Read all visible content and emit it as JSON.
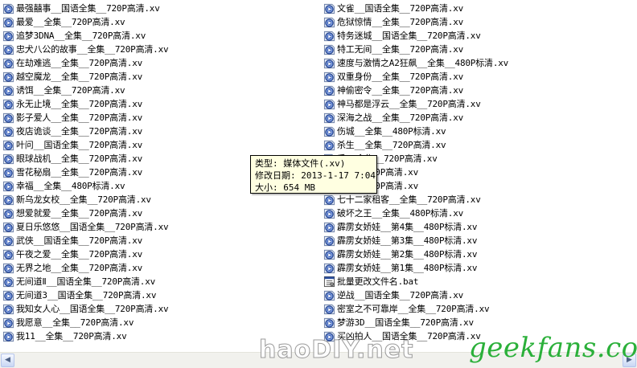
{
  "files_left": [
    "最强囍事__国语全集__720P高清.xv",
    "最爱__全集__720P高清.xv",
    "追梦3DNA__全集__720P高清.xv",
    "忠犬八公的故事__全集__720P高清.xv",
    "在劫难逃__全集__720P高清.xv",
    "越空魔龙__全集__720P高清.xv",
    "诱饵__全集__720P高清.xv",
    "永无止境__全集__720P高清.xv",
    "影子爱人__全集__720P高清.xv",
    "夜店诡谈__全集__720P高清.xv",
    "叶问__国语全集__720P高清.xv",
    "眼球战机__全集__720P高清.xv",
    "雪花秘扇__全集__720P高清.xv",
    "幸福__全集__480P标清.xv",
    "新乌龙女校__全集__720P高清.xv",
    "想爱就爱__全集__720P高清.xv",
    "夏日乐悠悠__国语全集__720P高清.xv",
    "武侠__国语全集__720P高清.xv",
    "午夜之爱__全集__720P高清.xv",
    "无界之地__全集__720P高清.xv",
    "无间道Ⅱ__国语全集__720P高清.xv",
    "无间道3__国语全集__720P高清.xv",
    "我知女人心__国语全集__720P高清.xv",
    "我愿意__全集__720P高清.xv",
    "我11__全集__720P高清.xv"
  ],
  "files_right": [
    "文雀__国语全集__720P高清.xv",
    "危狱惊情__全集__720P高清.xv",
    "特务迷城__国语全集__720P高清.xv",
    "特工无间__全集__720P高清.xv",
    "速度与激情之A2狂飙__全集__480P标清.xv",
    "双重身份__全集__720P高清.xv",
    "神偷密令__全集__720P高清.xv",
    "神马都是浮云__全集__720P高清.xv",
    "深海之战__全集__720P高清.xv",
    "伤城__全集__480P标清.xv",
    "杀生__全集__720P高清.xv",
    "手__全集__720P高清.xv",
    "全集__720P高清.xv",
    "全集__720P高清.xv",
    "七十二家租客__全集__720P高清.xv",
    "破坏之王__全集__480P标清.xv",
    "霹雳女娇娃__第4集__480P标清.xv",
    "霹雳女娇娃__第3集__480P标清.xv",
    "霹雳女娇娃__第2集__480P标清.xv",
    "霹雳女娇娃__第1集__480P标清.xv",
    "批量更改文件名.bat",
    "逆战__国语全集__720P高清.xv",
    "密室之不可靠岸__全集__720P高清.xv",
    "梦游3D__国语全集__720P高清.xv",
    "买凶拍人__国语全集__720P高清.xv"
  ],
  "tooltip": {
    "type_line": "类型: 媒体文件(.xv)",
    "date_line": "修改日期: 2013-1-17 7:04",
    "size_line": "大小: 654 MB"
  },
  "scrollbar": {
    "left_arrow": "◀",
    "right_arrow": "▶"
  },
  "watermarks": {
    "left": "haoDIY.net",
    "right": "geekfans.com"
  },
  "icons": {
    "media": "media-file-icon",
    "batch": "batch-file-icon"
  },
  "colors": {
    "tooltip_bg": "#ffffe1",
    "watermark_green": "#2bb03a"
  }
}
